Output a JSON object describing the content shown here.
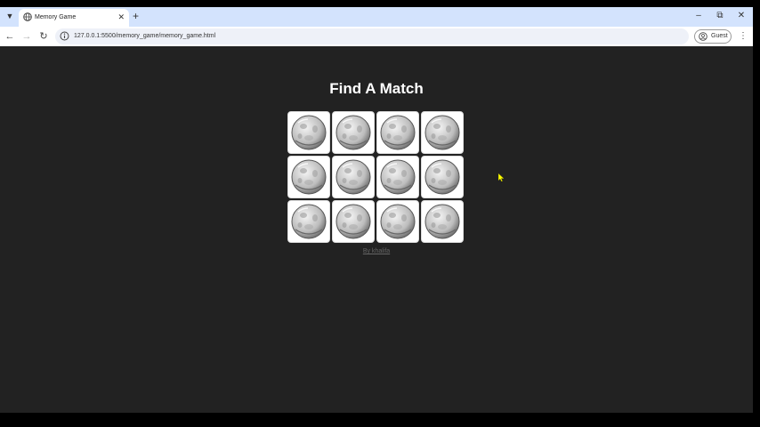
{
  "browser": {
    "tab_title": "Memory Game",
    "url": "127.0.0.1:5500/memory_game/memory_game.html",
    "profile_label": "Guest"
  },
  "page": {
    "heading": "Find A Match",
    "credit_link": "By khalifa",
    "cards": [
      {
        "state": "face-down",
        "icon": "moon-ball-icon"
      },
      {
        "state": "face-down",
        "icon": "moon-ball-icon"
      },
      {
        "state": "face-down",
        "icon": "moon-ball-icon"
      },
      {
        "state": "face-down",
        "icon": "moon-ball-icon"
      },
      {
        "state": "face-down",
        "icon": "moon-ball-icon"
      },
      {
        "state": "face-down",
        "icon": "moon-ball-icon"
      },
      {
        "state": "face-down",
        "icon": "moon-ball-icon"
      },
      {
        "state": "face-down",
        "icon": "moon-ball-icon"
      },
      {
        "state": "face-down",
        "icon": "moon-ball-icon"
      },
      {
        "state": "face-down",
        "icon": "moon-ball-icon"
      },
      {
        "state": "face-down",
        "icon": "moon-ball-icon"
      },
      {
        "state": "face-down",
        "icon": "moon-ball-icon"
      }
    ]
  },
  "colors": {
    "page_background": "#222222",
    "titlebar": "#d3e3fd",
    "heading": "#ffffff",
    "card_face": "#ffffff",
    "cursor": "#ffff00"
  }
}
